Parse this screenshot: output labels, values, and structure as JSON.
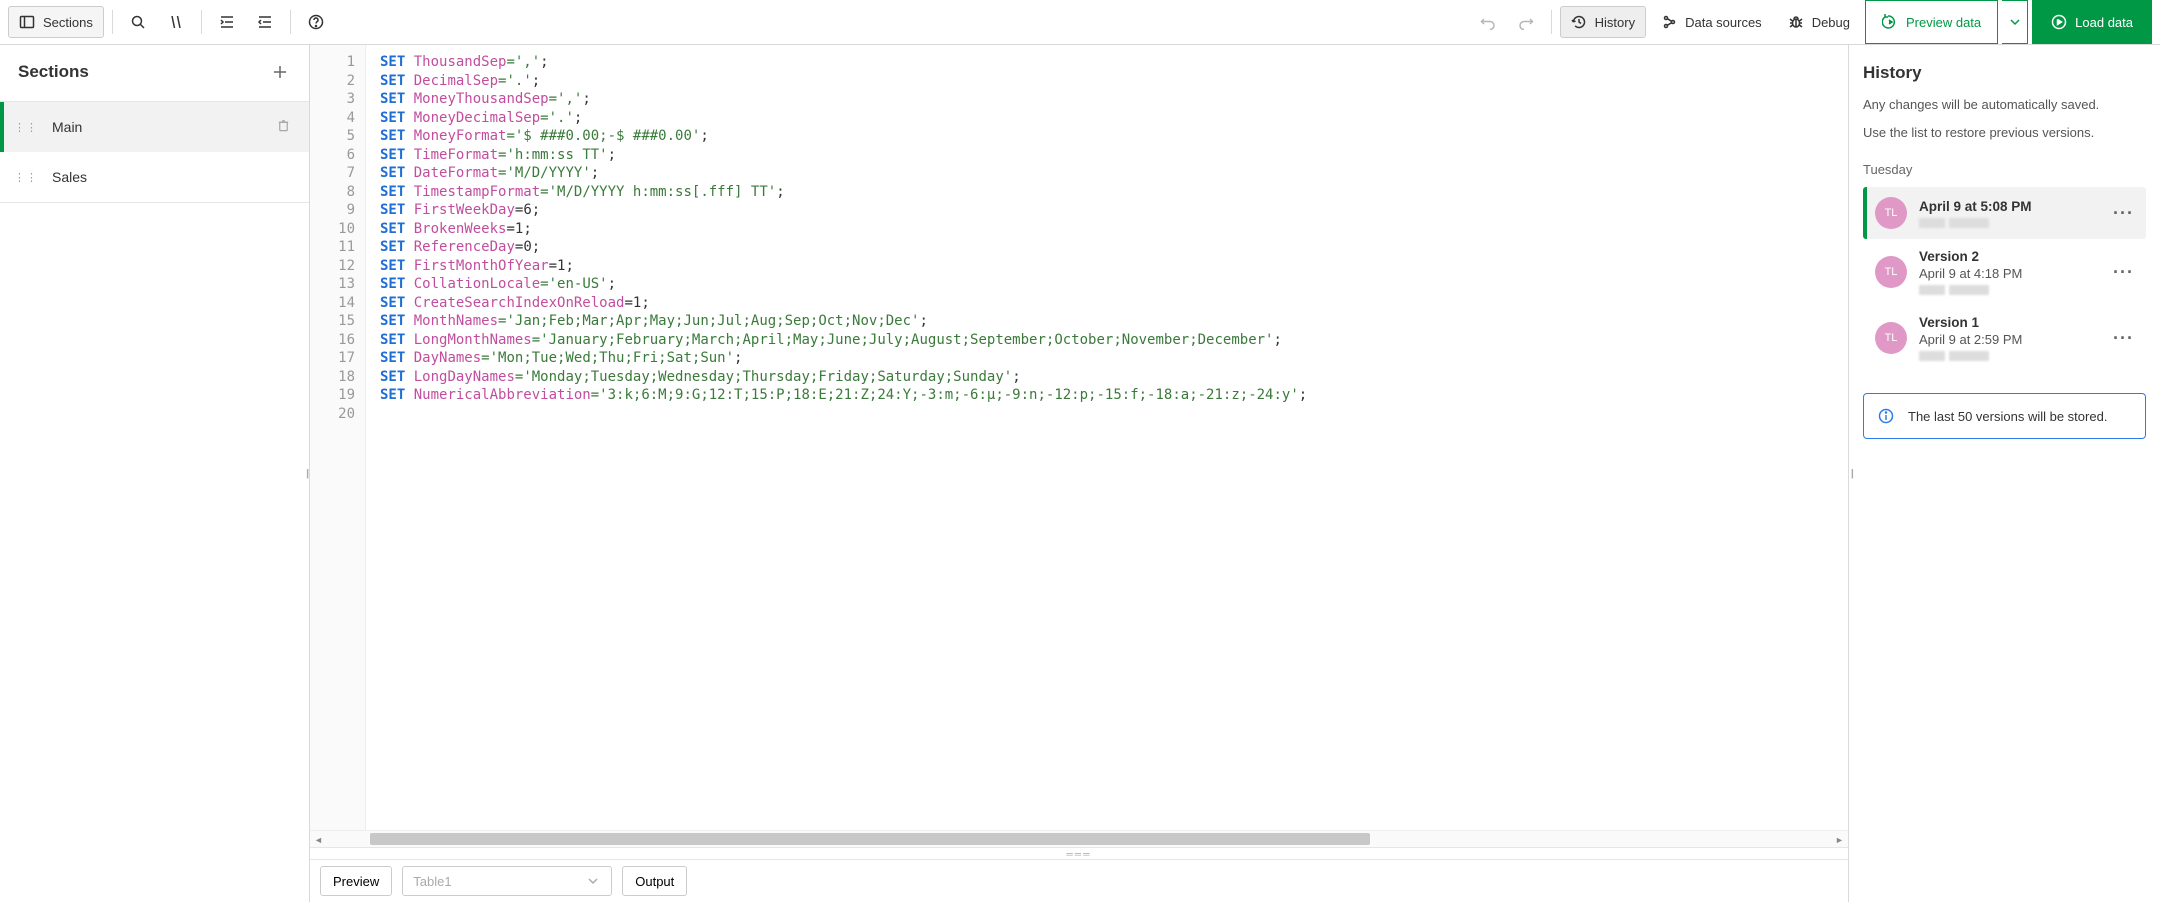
{
  "toolbar": {
    "sections_label": "Sections",
    "history_label": "History",
    "data_sources_label": "Data sources",
    "debug_label": "Debug",
    "preview_label": "Preview data",
    "load_label": "Load data"
  },
  "sidebar": {
    "title": "Sections",
    "items": [
      {
        "label": "Main",
        "active": true,
        "deletable": true
      },
      {
        "label": "Sales",
        "active": false,
        "deletable": false
      }
    ]
  },
  "editor": {
    "lines": [
      {
        "n": 1,
        "kw": "SET",
        "var": "ThousandSep",
        "rest": "=','",
        "semi": ";"
      },
      {
        "n": 2,
        "kw": "SET",
        "var": "DecimalSep",
        "rest": "='.'",
        "semi": ";"
      },
      {
        "n": 3,
        "kw": "SET",
        "var": "MoneyThousandSep",
        "rest": "=','",
        "semi": ";"
      },
      {
        "n": 4,
        "kw": "SET",
        "var": "MoneyDecimalSep",
        "rest": "='.'",
        "semi": ";"
      },
      {
        "n": 5,
        "kw": "SET",
        "var": "MoneyFormat",
        "rest": "='$ ###0.00;-$ ###0.00'",
        "semi": ";"
      },
      {
        "n": 6,
        "kw": "SET",
        "var": "TimeFormat",
        "rest": "='h:mm:ss TT'",
        "semi": ";"
      },
      {
        "n": 7,
        "kw": "SET",
        "var": "DateFormat",
        "rest": "='M/D/YYYY'",
        "semi": ";"
      },
      {
        "n": 8,
        "kw": "SET",
        "var": "TimestampFormat",
        "rest": "='M/D/YYYY h:mm:ss[.fff] TT'",
        "semi": ";"
      },
      {
        "n": 9,
        "kw": "SET",
        "var": "FirstWeekDay",
        "rest_num": "=6",
        "semi": ";"
      },
      {
        "n": 10,
        "kw": "SET",
        "var": "BrokenWeeks",
        "rest_num": "=1",
        "semi": ";"
      },
      {
        "n": 11,
        "kw": "SET",
        "var": "ReferenceDay",
        "rest_num": "=0",
        "semi": ";"
      },
      {
        "n": 12,
        "kw": "SET",
        "var": "FirstMonthOfYear",
        "rest_num": "=1",
        "semi": ";"
      },
      {
        "n": 13,
        "kw": "SET",
        "var": "CollationLocale",
        "rest": "='en-US'",
        "semi": ";"
      },
      {
        "n": 14,
        "kw": "SET",
        "var": "CreateSearchIndexOnReload",
        "rest_num": "=1",
        "semi": ";"
      },
      {
        "n": 15,
        "kw": "SET",
        "var": "MonthNames",
        "rest": "='Jan;Feb;Mar;Apr;May;Jun;Jul;Aug;Sep;Oct;Nov;Dec'",
        "semi": ";"
      },
      {
        "n": 16,
        "kw": "SET",
        "var": "LongMonthNames",
        "rest": "='January;February;March;April;May;June;July;August;September;October;November;December'",
        "semi": ";"
      },
      {
        "n": 17,
        "kw": "SET",
        "var": "DayNames",
        "rest": "='Mon;Tue;Wed;Thu;Fri;Sat;Sun'",
        "semi": ";"
      },
      {
        "n": 18,
        "kw": "SET",
        "var": "LongDayNames",
        "rest": "='Monday;Tuesday;Wednesday;Thursday;Friday;Saturday;Sunday'",
        "semi": ";"
      },
      {
        "n": 19,
        "kw": "SET",
        "var": "NumericalAbbreviation",
        "rest": "='3:k;6:M;9:G;12:T;15:P;18:E;21:Z;24:Y;-3:m;-6:μ;-9:n;-12:p;-15:f;-18:a;-21:z;-24:y'",
        "semi": ";"
      },
      {
        "n": 20,
        "blank": true
      }
    ]
  },
  "bottom": {
    "preview_label": "Preview",
    "table_placeholder": "Table1",
    "output_label": "Output"
  },
  "history": {
    "title": "History",
    "desc1": "Any changes will be automatically saved.",
    "desc2": "Use the list to restore previous versions.",
    "day": "Tuesday",
    "items": [
      {
        "name": "April 9 at 5:08 PM",
        "time": "",
        "avatar": "TL",
        "active": true
      },
      {
        "name": "Version 2",
        "time": "April 9 at 4:18 PM",
        "avatar": "TL",
        "active": false
      },
      {
        "name": "Version 1",
        "time": "April 9 at 2:59 PM",
        "avatar": "TL",
        "active": false
      }
    ],
    "info": "The last 50 versions will be stored."
  }
}
